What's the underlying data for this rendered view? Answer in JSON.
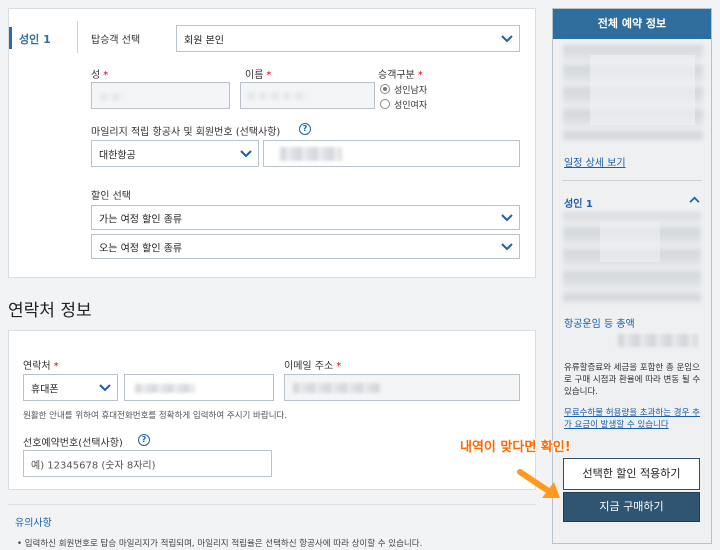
{
  "passenger": {
    "tag": "성인 1",
    "type_label": "탑승객 선택",
    "type_value": "회원 본인",
    "surname_label": "성",
    "given_label": "이름",
    "gender_label": "승객구분",
    "gender_options": [
      "성인남자",
      "성인여자"
    ],
    "mileage_label": "마일리지 적립 항공사 및 회원번호 (선택사항)",
    "airline_value": "대한항공",
    "discount_label": "할인 선택",
    "outbound_value": "가는 여정 할인 종류",
    "inbound_value": "오는 여정 할인 종류"
  },
  "contact": {
    "section_title": "연락처 정보",
    "phone_label": "연락처",
    "phone_type": "휴대폰",
    "email_label": "이메일 주소",
    "hint": "원활한 안내를 위하여 휴대전화번호를 정확하게 입력하여 주시기 바랍니다.",
    "pref_label": "선호예약번호(선택사항)",
    "pref_placeholder": "예) 12345678 (숫자 8자리)"
  },
  "notice": {
    "title": "유의사항",
    "bullet": "입력하신 회원번호로 탑승 마일리지가 적립되며, 마일리지 적립율은 선택하신 항공사에 따라 상이할 수 있습니다."
  },
  "sidebar": {
    "title": "전체 예약 정보",
    "detail_link": "일정 상세 보기",
    "pax_label": "성인 1",
    "fare_total_label": "항공운임 등 총액",
    "fare_note": "유류할증료와 세금을 포함한 총 운임으로 구매 시점과 환율에 따라 변동 될 수 있습니다.",
    "baggage_link": "무료수하물 허용량을 초과하는 경우 추가 요금이 발생할 수 있습니다",
    "apply_button": "선택한 할인 적용하기",
    "buy_button": "지금 구매하기"
  },
  "annotation": "내역이 맞다면 확인!",
  "colors": {
    "accent": "#2f6d9c",
    "button": "#2f5573",
    "required": "#d0021b",
    "highlight": "#ff6a00"
  }
}
